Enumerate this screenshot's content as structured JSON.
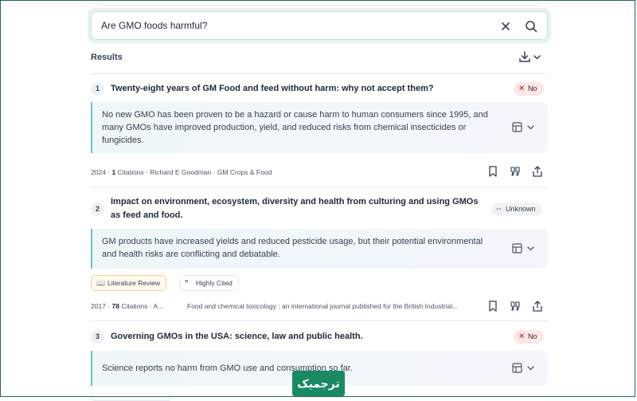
{
  "search": {
    "query": "Are GMO foods harmful?"
  },
  "results_header": {
    "title": "Results"
  },
  "results": [
    {
      "index": "1",
      "title": "Twenty-eight years of GM Food and feed without harm: why not accept them?",
      "verdict": "No",
      "summary": "No new GMO has been proven to be a hazard or cause harm to human consumers since 1995, and many GMOs have improved production, yield, and reduced risks from chemical insecticides or fungicides.",
      "year": "2024",
      "citations_count": "1",
      "citations_label": "Citations",
      "authors": "Richard E Goodman",
      "journal": "GM Crops & Food"
    },
    {
      "index": "2",
      "title": "Impact on environment, ecosystem, diversity and health from culturing and using GMOs as feed and food.",
      "verdict": "Unknown",
      "summary": "GM products have increased yields and reduced pesticide usage, but their potential environmental and health risks are conflicting and debatable.",
      "tags": [
        "Literature Review",
        "Highly Cited"
      ],
      "year": "2017",
      "citations_count": "78",
      "citations_label": "Citations",
      "authors": "A...",
      "journal": "Food and chemical toxicology : an international journal published for the British Industrial..."
    },
    {
      "index": "3",
      "title": "Governing GMOs in the USA: science, law and public health.",
      "verdict": "No",
      "summary": "Science reports no harm from GMO use and consumption so far."
    }
  ],
  "watermark": {
    "text": "ترجمیک"
  },
  "colors": {
    "accent": "#6cc4c0",
    "no_badge": "#fde7e7",
    "brand": "#1a8a62"
  }
}
